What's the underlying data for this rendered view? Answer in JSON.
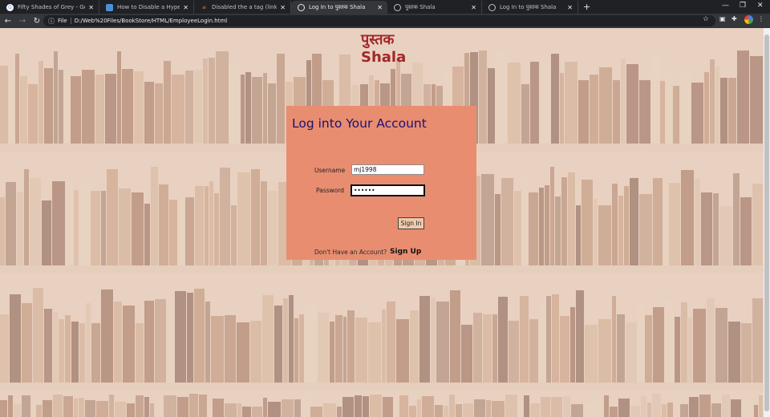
{
  "browser": {
    "tabs": [
      {
        "title": "Fifty Shades of Grey - Google Se...",
        "icon": "google-icon",
        "active": false
      },
      {
        "title": "How to Disable a Hyperlink usin...",
        "icon": "site-icon",
        "active": false
      },
      {
        "title": "Disabled the a tag (link) by using...",
        "icon": "stack-icon",
        "active": false
      },
      {
        "title": "Log In to पुस्तक Shala",
        "icon": "globe-icon",
        "active": true
      },
      {
        "title": "पुस्तक Shala",
        "icon": "globe-icon",
        "active": false
      },
      {
        "title": "Log In to पुस्तक Shala",
        "icon": "globe-icon",
        "active": false
      }
    ],
    "address": {
      "scheme": "File",
      "url": "D:/Web%20Files/BookStore/HTML/EmployeeLogin.html"
    }
  },
  "page": {
    "brand_line1": "पुस्तक",
    "brand_line2": "Shala",
    "card": {
      "title": "Log into Your Account",
      "username_label": "Username",
      "username_value": "mj1998",
      "password_label": "Password",
      "password_value": "••••••",
      "signin_label": "Sign In",
      "no_account_text": "Don't Have an Account?",
      "signup_label": "Sign Up"
    }
  },
  "colors": {
    "brand": "#a3262a",
    "card_bg": "#e98d70",
    "card_title": "#1b1173"
  }
}
